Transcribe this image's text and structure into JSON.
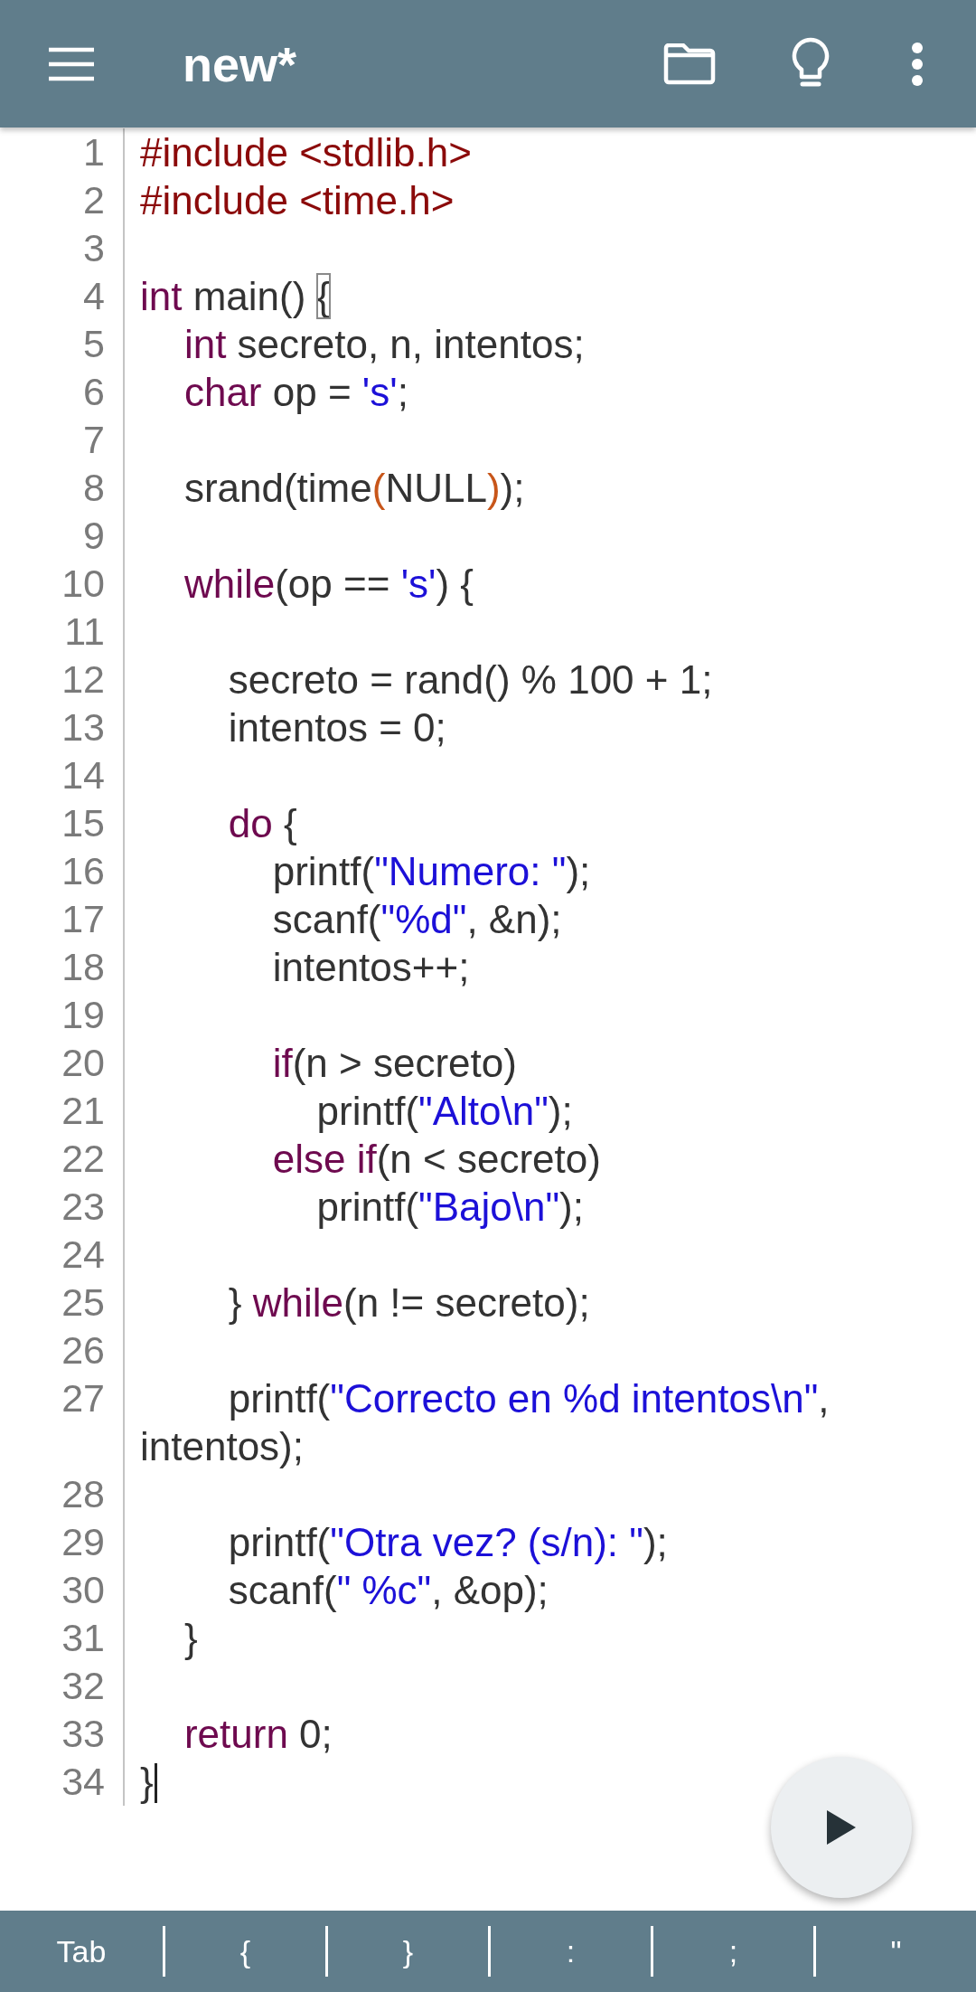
{
  "toolbar": {
    "title": "new*"
  },
  "lines": [
    {
      "number": "1",
      "tokens": [
        {
          "kind": "directive",
          "text": "#include <stdlib.h>"
        }
      ]
    },
    {
      "number": "2",
      "tokens": [
        {
          "kind": "directive",
          "text": "#include <time.h>"
        }
      ]
    },
    {
      "number": "3"
    },
    {
      "number": "4",
      "tokens": [
        {
          "kind": "keyword",
          "text": "int"
        },
        {
          "kind": "plain",
          "text": " main() "
        },
        {
          "kind": "match_box",
          "text": "{"
        }
      ]
    },
    {
      "number": "5",
      "tokens": [
        {
          "kind": "keyword",
          "text": "    int"
        },
        {
          "kind": "plain",
          "text": " secreto, n, intentos;"
        }
      ]
    },
    {
      "number": "6",
      "tokens": [
        {
          "kind": "keyword",
          "text": "    char"
        },
        {
          "kind": "plain",
          "text": " op = "
        },
        {
          "kind": "string",
          "text": "'s'"
        },
        {
          "kind": "plain",
          "text": ";"
        }
      ]
    },
    {
      "number": "7"
    },
    {
      "number": "8",
      "tokens": [
        {
          "kind": "plain",
          "text": "    srand(time"
        },
        {
          "kind": "match_paren",
          "text": "("
        },
        {
          "kind": "plain",
          "text": "NULL"
        },
        {
          "kind": "match_paren",
          "text": ")"
        },
        {
          "kind": "plain",
          "text": ");"
        }
      ]
    },
    {
      "number": "9"
    },
    {
      "number": "10",
      "tokens": [
        {
          "kind": "keyword",
          "text": "    while"
        },
        {
          "kind": "plain",
          "text": "(op == "
        },
        {
          "kind": "string",
          "text": "'s'"
        },
        {
          "kind": "plain",
          "text": ") {"
        }
      ]
    },
    {
      "number": "11"
    },
    {
      "number": "12",
      "tokens": [
        {
          "kind": "plain",
          "text": "        secreto = rand() % 100 + 1;"
        }
      ]
    },
    {
      "number": "13",
      "tokens": [
        {
          "kind": "plain",
          "text": "        intentos = 0;"
        }
      ]
    },
    {
      "number": "14"
    },
    {
      "number": "15",
      "tokens": [
        {
          "kind": "keyword",
          "text": "        do"
        },
        {
          "kind": "plain",
          "text": " {"
        }
      ]
    },
    {
      "number": "16",
      "tokens": [
        {
          "kind": "plain",
          "text": "            printf("
        },
        {
          "kind": "string",
          "text": "\"Numero: \""
        },
        {
          "kind": "plain",
          "text": ");"
        }
      ]
    },
    {
      "number": "17",
      "tokens": [
        {
          "kind": "plain",
          "text": "            scanf("
        },
        {
          "kind": "string",
          "text": "\"%d\""
        },
        {
          "kind": "plain",
          "text": ", &n);"
        }
      ]
    },
    {
      "number": "18",
      "tokens": [
        {
          "kind": "plain",
          "text": "            intentos++;"
        }
      ]
    },
    {
      "number": "19"
    },
    {
      "number": "20",
      "tokens": [
        {
          "kind": "keyword",
          "text": "            if"
        },
        {
          "kind": "plain",
          "text": "(n > secreto)"
        }
      ]
    },
    {
      "number": "21",
      "tokens": [
        {
          "kind": "plain",
          "text": "                printf("
        },
        {
          "kind": "string",
          "text": "\"Alto\\n\""
        },
        {
          "kind": "plain",
          "text": ");"
        }
      ]
    },
    {
      "number": "22",
      "tokens": [
        {
          "kind": "keyword",
          "text": "            else if"
        },
        {
          "kind": "plain",
          "text": "(n < secreto)"
        }
      ]
    },
    {
      "number": "23",
      "tokens": [
        {
          "kind": "plain",
          "text": "                printf("
        },
        {
          "kind": "string",
          "text": "\"Bajo\\n\""
        },
        {
          "kind": "plain",
          "text": ");"
        }
      ]
    },
    {
      "number": "24"
    },
    {
      "number": "25",
      "tokens": [
        {
          "kind": "plain",
          "text": "        } "
        },
        {
          "kind": "keyword",
          "text": "while"
        },
        {
          "kind": "plain",
          "text": "(n != secreto);"
        }
      ]
    },
    {
      "number": "26"
    },
    {
      "number": "27",
      "tokens": [
        {
          "kind": "plain",
          "text": "        printf("
        },
        {
          "kind": "string",
          "text": "\"Correcto en %d intentos\\n\""
        },
        {
          "kind": "plain",
          "text": ", intentos);"
        }
      ]
    },
    {
      "number": "28"
    },
    {
      "number": "29",
      "tokens": [
        {
          "kind": "plain",
          "text": "        printf("
        },
        {
          "kind": "string",
          "text": "\"Otra vez? (s/n): \""
        },
        {
          "kind": "plain",
          "text": ");"
        }
      ]
    },
    {
      "number": "30",
      "tokens": [
        {
          "kind": "plain",
          "text": "        scanf("
        },
        {
          "kind": "string",
          "text": "\" %c\""
        },
        {
          "kind": "plain",
          "text": ", &op);"
        }
      ]
    },
    {
      "number": "31",
      "tokens": [
        {
          "kind": "plain",
          "text": "    }"
        }
      ]
    },
    {
      "number": "32"
    },
    {
      "number": "33",
      "tokens": [
        {
          "kind": "keyword",
          "text": "    return"
        },
        {
          "kind": "plain",
          "text": " 0;"
        }
      ]
    },
    {
      "number": "34",
      "tokens": [
        {
          "kind": "plain",
          "text": "}"
        }
      ],
      "cursor": true
    }
  ],
  "keys": [
    "Tab",
    "{",
    "}",
    ":",
    ";",
    "\""
  ]
}
